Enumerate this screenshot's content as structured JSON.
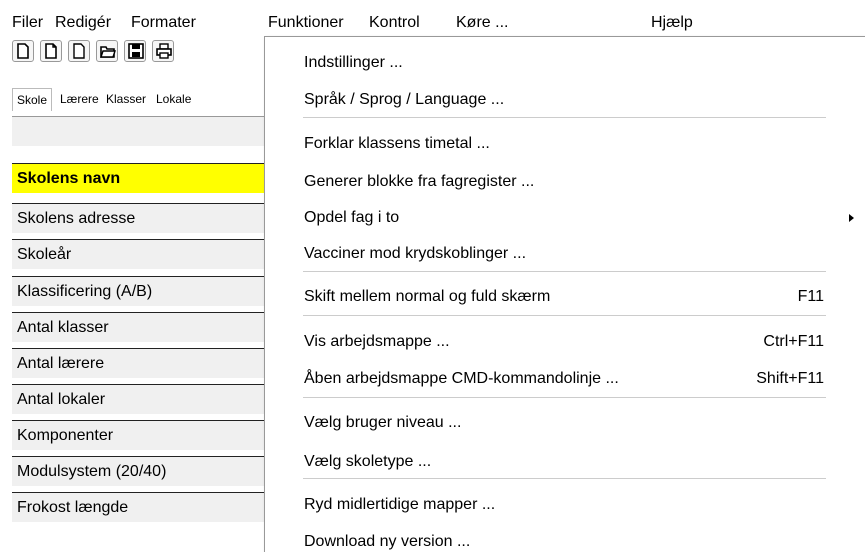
{
  "menubar": {
    "items": [
      "Filer",
      "Redigér",
      "Formater",
      "Funktioner",
      "Kontrol",
      "Køre ...",
      "Hjælp"
    ]
  },
  "toolbar": {
    "icons": [
      "new-doc-icon",
      "new-doc-icon",
      "new-doc-icon",
      "open-folder-icon",
      "save-icon",
      "print-icon"
    ]
  },
  "tabs": [
    "Skole",
    "Lærere",
    "Klasser",
    "Lokale"
  ],
  "grid": {
    "rows": [
      "Skolens navn",
      "Skolens adresse",
      "Skoleår",
      "Klassificering (A/B)",
      "Antal klasser",
      "Antal lærere",
      "Antal lokaler",
      "Komponenter",
      "Modulsystem (20/40)",
      "Frokost længde"
    ],
    "selected_color": "#ffff00"
  },
  "dropdown": {
    "items": [
      {
        "label": "Indstillinger ...",
        "shortcut": ""
      },
      {
        "label": "Språk / Sprog / Language ...",
        "shortcut": ""
      },
      {
        "label": "Forklar klassens timetal ...",
        "shortcut": ""
      },
      {
        "label": "Generer blokke fra fagregister ...",
        "shortcut": ""
      },
      {
        "label": "Opdel fag i to",
        "shortcut": ""
      },
      {
        "label": "Vacciner mod krydskoblinger ...",
        "shortcut": ""
      },
      {
        "label": "Skift mellem normal og fuld skærm",
        "shortcut": "F11"
      },
      {
        "label": "Vis arbejdsmappe ...",
        "shortcut": "Ctrl+F11"
      },
      {
        "label": "Åben arbejdsmappe CMD-kommandolinje ...",
        "shortcut": "Shift+F11"
      },
      {
        "label": "Vælg bruger niveau ...",
        "shortcut": ""
      },
      {
        "label": "Vælg skoletype ...",
        "shortcut": ""
      },
      {
        "label": "Ryd midlertidige mapper ...",
        "shortcut": ""
      },
      {
        "label": "Download ny version ...",
        "shortcut": ""
      }
    ]
  }
}
